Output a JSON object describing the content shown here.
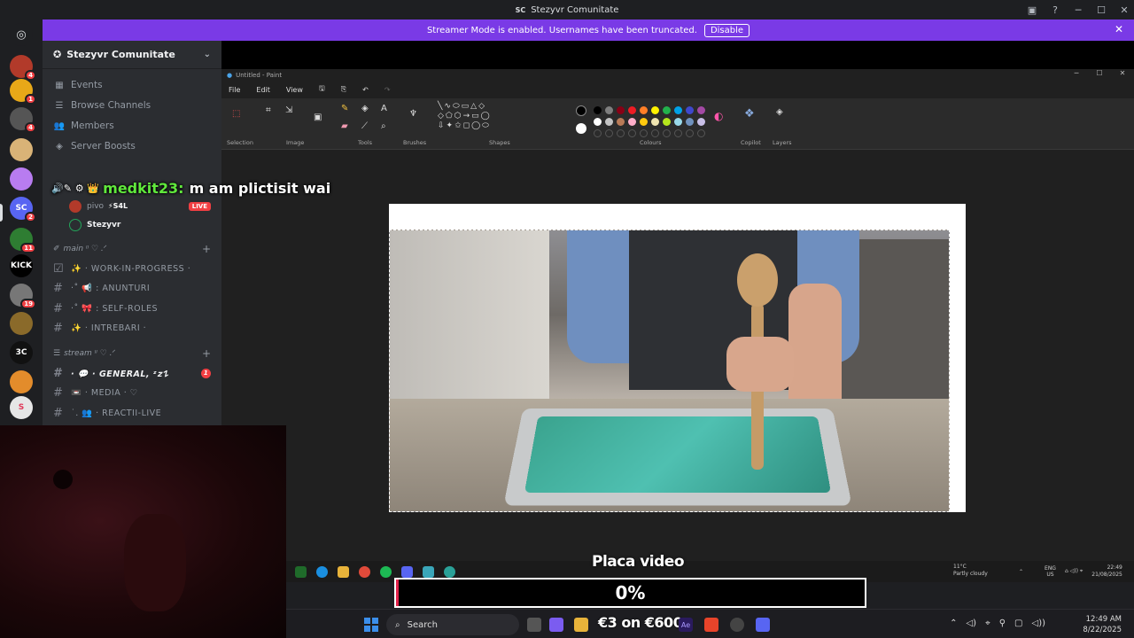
{
  "window": {
    "app_initials": "SC",
    "title": "Stezyvr Comunitate"
  },
  "banner": {
    "text": "Streamer Mode is enabled. Usernames have been truncated.",
    "disable_label": "Disable"
  },
  "servers": [
    {
      "initials": "",
      "color": "#b23a2a",
      "badge": "4"
    },
    {
      "initials": "",
      "color": "#e8a818",
      "badge": "1"
    },
    {
      "initials": "",
      "color": "#555",
      "badge": "4"
    },
    {
      "initials": "",
      "color": "#d9b377",
      "badge": ""
    },
    {
      "initials": "",
      "color": "#b87cf0",
      "badge": ""
    },
    {
      "initials": "SC",
      "color": "#5865f2",
      "badge": "2"
    },
    {
      "initials": "",
      "color": "#2e7d32",
      "badge": "11"
    },
    {
      "initials": "KICK",
      "color": "#000",
      "badge": ""
    },
    {
      "initials": "",
      "color": "#777",
      "badge": "19"
    },
    {
      "initials": "",
      "color": "#8a6a2a",
      "badge": ""
    },
    {
      "initials": "3C",
      "color": "#111",
      "badge": ""
    },
    {
      "initials": "",
      "color": "#e38c2b",
      "badge": ""
    },
    {
      "initials": "S",
      "color": "#e6e6e6",
      "badge": ""
    }
  ],
  "sidebar": {
    "server_name": "Stezyvr Comunitate",
    "nav": [
      {
        "label": "Events",
        "icon": "calendar-icon"
      },
      {
        "label": "Browse Channels",
        "icon": "browse-icon"
      },
      {
        "label": "Members",
        "icon": "members-icon"
      },
      {
        "label": "Server Boosts",
        "icon": "boost-icon"
      }
    ],
    "voice_users": [
      {
        "name": "pivo",
        "tag": "⚡S4L",
        "live": "LIVE"
      },
      {
        "name": "Stezyvr",
        "tag": "",
        "live": ""
      }
    ],
    "categories": [
      {
        "name": "main ᵎᵎ ♡ .ᐟ",
        "channels": [
          {
            "name": "✨ · WORK-IN-PROGRESS ·",
            "unread": false,
            "count": ""
          },
          {
            "name": "·˚ 📢 : ANUNTURI",
            "unread": false,
            "count": ""
          },
          {
            "name": "·˚ 🎀 : SELF-ROLES",
            "unread": false,
            "count": ""
          },
          {
            "name": "✨ · INTREBARI ·",
            "unread": false,
            "count": ""
          }
        ]
      },
      {
        "name": "stream ᵎᵎ ♡ .ᐟ",
        "channels": [
          {
            "name": "· 💬 · GENERAL, ᶻ𝘇𐰁",
            "unread": true,
            "count": "1"
          },
          {
            "name": "📼 · MEDIA · ♡",
            "unread": false,
            "count": ""
          },
          {
            "name": "˙. 👥 · REACTII-LIVE",
            "unread": false,
            "count": ""
          }
        ]
      }
    ]
  },
  "chat_overlay": {
    "username": "medkit23:",
    "message": "m am plictisit wai"
  },
  "paint": {
    "title": "Untitled - Paint",
    "menu": [
      "File",
      "Edit",
      "View"
    ],
    "groups": [
      "Selection",
      "Image",
      "Tools",
      "Brushes",
      "Shapes",
      "Colours",
      "Copilot",
      "Layers"
    ],
    "palette": [
      "#000000",
      "#7f7f7f",
      "#880015",
      "#ed1c24",
      "#ff7f27",
      "#fff200",
      "#22b14c",
      "#00a2e8",
      "#3f48cc",
      "#a349a4",
      "#ffffff",
      "#c3c3c3",
      "#b97a57",
      "#ffaec9",
      "#ffc90e",
      "#efe4b0",
      "#b5e61d",
      "#99d9ea",
      "#7092be",
      "#c8bfe7"
    ]
  },
  "overlay": {
    "label": "Placa video",
    "progress_text": "0%",
    "progress_percent": 0
  },
  "paint_taskbar": {
    "weather_temp": "11°C",
    "weather_desc": "Partly cloudy",
    "lang": "ENG",
    "region": "US",
    "time": "22:49",
    "date": "21/08/2025"
  },
  "taskbar": {
    "search_placeholder": "Search",
    "price_text": "€3 on €600",
    "time": "12:49 AM",
    "date": "8/22/2025"
  }
}
